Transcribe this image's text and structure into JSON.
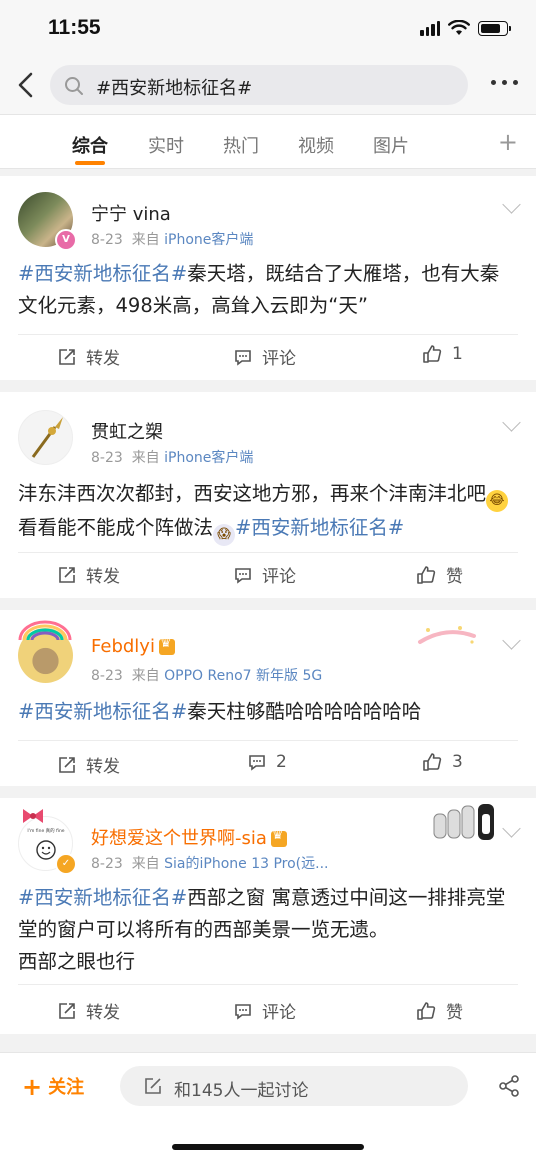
{
  "status": {
    "time": "11:55",
    "battery_level": 0.85
  },
  "search": {
    "query": "#西安新地标征名#"
  },
  "tabs": [
    {
      "label": "综合"
    },
    {
      "label": "实时"
    },
    {
      "label": "热门"
    },
    {
      "label": "视频"
    },
    {
      "label": "图片"
    }
  ],
  "actions": {
    "repost": "转发",
    "comment": "评论",
    "like": "赞"
  },
  "posts": [
    {
      "user": "宁宁 vina",
      "date": "8-23",
      "from": "来自",
      "source": "iPhone客户端",
      "tag": "#西安新地标征名#",
      "body": "秦天塔，既结合了大雁塔，也有大秦文化元素，498米高，高耸入云即为“天”",
      "likes": "1"
    },
    {
      "user": "贯虹之槊",
      "date": "8-23",
      "from": "来自",
      "source": "iPhone客户端",
      "body1": "沣东沣西次次都封，西安这地方邪，再来个沣南沣北吧",
      "body2": "看看能不能成个阵做法",
      "tag": "#西安新地标征名#"
    },
    {
      "user": "Febdlyi",
      "date": "8-23",
      "from": "来自",
      "source": "OPPO Reno7 新年版 5G",
      "tag": "#西安新地标征名#",
      "body": "秦天柱够酷哈哈哈哈哈哈哈",
      "comments": "2",
      "likes": "3"
    },
    {
      "user": "好想爱这个世界啊-sia",
      "date": "8-23",
      "from": "来自",
      "source": "Sia的iPhone 13 Pro(远...",
      "avatar_caption": "I'm fine 真的 fine",
      "tag": "#西安新地标征名#",
      "body": "西部之窗 寓意透过中间这一排排亮堂堂的窗户可以将所有的西部美景一览无遗。",
      "body_line3": "西部之眼也行"
    }
  ],
  "bottom": {
    "follow": "关注",
    "discuss": "和145人一起讨论"
  },
  "colors": {
    "accent": "#ff8200",
    "link": "#4a79b5",
    "vip_name": "#f86e00"
  }
}
